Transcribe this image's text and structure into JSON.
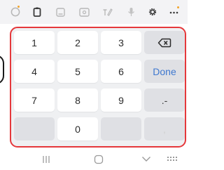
{
  "toolbar": {
    "icons": [
      "emoji-icon",
      "clipboard-icon",
      "sticker-icon",
      "gif-icon",
      "handwriting-icon",
      "mic-icon",
      "settings-icon",
      "more-icon"
    ]
  },
  "keypad": {
    "rows": [
      [
        "1",
        "2",
        "3",
        "backspace"
      ],
      [
        "4",
        "5",
        "6",
        "Done"
      ],
      [
        "7",
        "8",
        "9",
        ".-"
      ],
      [
        "",
        "0",
        "",
        ","
      ]
    ],
    "done_label": "Done",
    "punct_label": ".-",
    "comma_label": ","
  },
  "colors": {
    "accent": "#3f78cf",
    "highlight_border": "#e5383b",
    "key_background": "#ffffff",
    "function_key_background": "#dfe0e4",
    "panel_background": "#eff0f2"
  },
  "navbar": {
    "icons": [
      "recent-apps-icon",
      "home-icon",
      "hide-keyboard-icon",
      "keyboard-switch-icon"
    ]
  }
}
